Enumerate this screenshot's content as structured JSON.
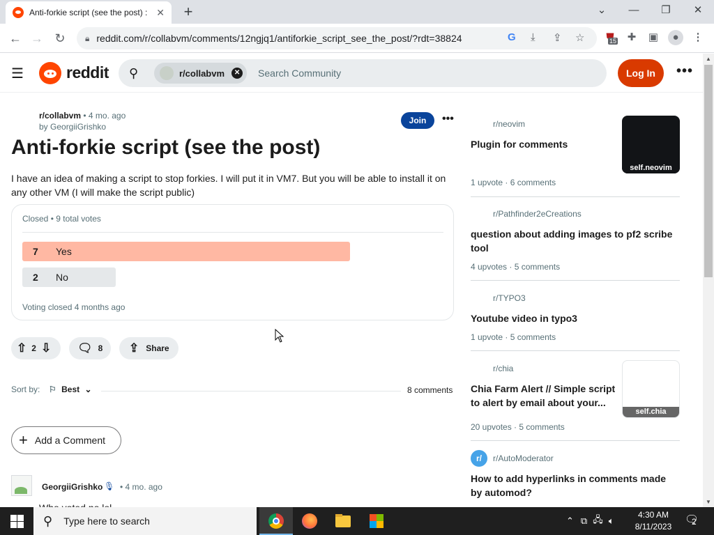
{
  "browser": {
    "tab_title": "Anti-forkie script (see the post) :",
    "tab_close": "✕",
    "new_tab": "+",
    "url": "reddit.com/r/collabvm/comments/12ngjq1/antiforkie_script_see_the_post/?rdt=38824",
    "extension_badge": "15",
    "window_controls": [
      "⌄",
      "—",
      "❐",
      "✕"
    ]
  },
  "header": {
    "wordmark": "reddit",
    "search_chip": "r/collabvm",
    "search_placeholder": "Search Community",
    "login_label": "Log In",
    "more": "•••"
  },
  "post": {
    "subreddit": "r/collabvm",
    "age": "• 4 mo. ago",
    "author_line": "by GeorgiiGrishko",
    "join_label": "Join",
    "more": "•••",
    "title": "Anti-forkie script (see the post)",
    "body": "I have an idea of making a script to stop forkies. I will put it in VM7. But you will be able to install it on any other VM (I will make the script public)",
    "poll": {
      "header": "Closed • 9 total votes",
      "options": [
        {
          "count": "7",
          "label": "Yes",
          "fraction": 0.7778,
          "color": "#ffb8a3"
        },
        {
          "count": "2",
          "label": "No",
          "fraction": 0.2222,
          "color": "#e5e8ea"
        }
      ],
      "footer": "Voting closed 4 months ago"
    },
    "votes": "2",
    "comments_count": "8",
    "share_label": "Share"
  },
  "comments_section": {
    "sort_by_label": "Sort by:",
    "sort_value": "Best",
    "count_label": "8 comments",
    "add_comment_label": "Add a Comment",
    "first_comment": {
      "author": "GeorgiiGrishko",
      "age": "• 4 mo. ago",
      "text": "Who voted no lol"
    }
  },
  "sidebar": {
    "items": [
      {
        "subreddit": "r/neovim",
        "title": "Plugin for comments",
        "upvotes": "1 upvote",
        "comments": "6 comments",
        "thumb": "self.neovim"
      },
      {
        "subreddit": "r/Pathfinder2eCreations",
        "title": "question about adding images to pf2 scribe tool",
        "upvotes": "4 upvotes",
        "comments": "5 comments"
      },
      {
        "subreddit": "r/TYPO3",
        "title": "Youtube video in typo3",
        "upvotes": "1 upvote",
        "comments": "5 comments"
      },
      {
        "subreddit": "r/chia",
        "title": "Chia Farm Alert // Simple script to alert by email about your...",
        "upvotes": "20 upvotes",
        "comments": "5 comments",
        "thumb": "self.chia"
      },
      {
        "subreddit": "r/AutoModerator",
        "title": "How to add hyperlinks in comments made by automod?",
        "avatar": "r/"
      }
    ]
  },
  "taskbar": {
    "search_placeholder": "Type here to search",
    "time": "4:30 AM",
    "date": "8/11/2023",
    "notifications": "2"
  }
}
